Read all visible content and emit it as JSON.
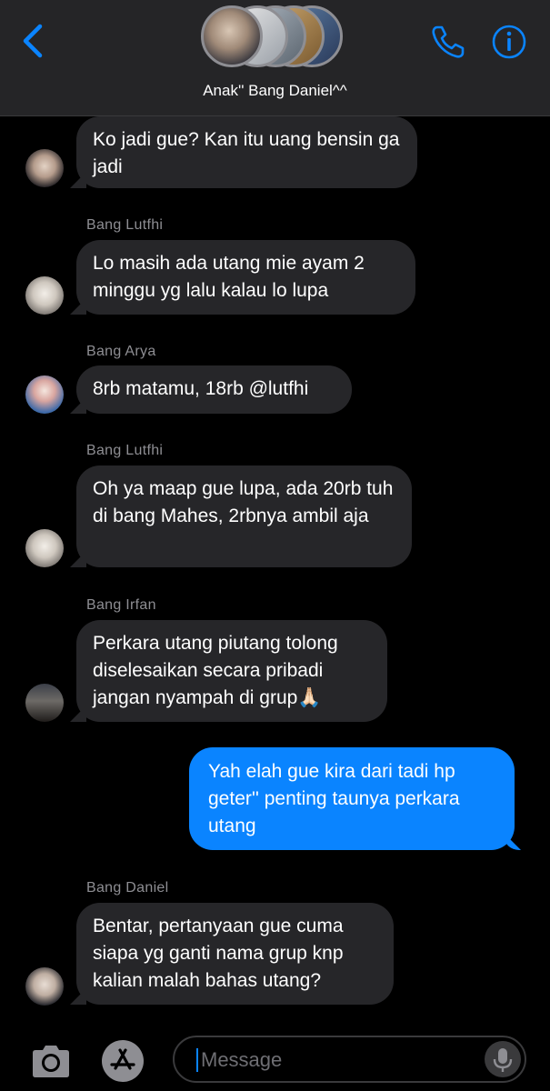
{
  "header": {
    "group_name": "Anak'' Bang Daniel^^"
  },
  "messages": [
    {
      "sender": "",
      "text": "Ko jadi gue? Kan itu uang bensin ga jadi",
      "from_me": false
    },
    {
      "sender": "Bang Lutfhi",
      "text": "Lo masih ada utang mie ayam 2 minggu yg lalu kalau lo lupa",
      "from_me": false
    },
    {
      "sender": "Bang Arya",
      "text": "8rb matamu, 18rb @lutfhi",
      "from_me": false
    },
    {
      "sender": "Bang Lutfhi",
      "text": "Oh ya maap gue lupa, ada 20rb tuh di bang Mahes, 2rbnya ambil aja",
      "from_me": false
    },
    {
      "sender": "Bang Irfan",
      "text": "Perkara utang piutang tolong diselesaikan secara pribadi jangan nyampah di grup🙏🏻",
      "from_me": false
    },
    {
      "sender": "",
      "text": "Yah elah gue kira dari tadi hp geter'' penting taunya perkara utang",
      "from_me": true
    },
    {
      "sender": "Bang Daniel",
      "text": "Bentar, pertanyaan gue cuma siapa yg ganti nama grup knp kalian malah bahas utang?",
      "from_me": false
    }
  ],
  "composer": {
    "placeholder": "Message"
  },
  "colors": {
    "accent": "#0a84ff",
    "incoming_bubble": "#262629",
    "header_bg": "#252527"
  },
  "icons": {
    "back": "chevron-left-icon",
    "call": "phone-icon",
    "info": "info-icon",
    "camera": "camera-icon",
    "apps": "app-store-icon",
    "mic": "microphone-icon"
  }
}
